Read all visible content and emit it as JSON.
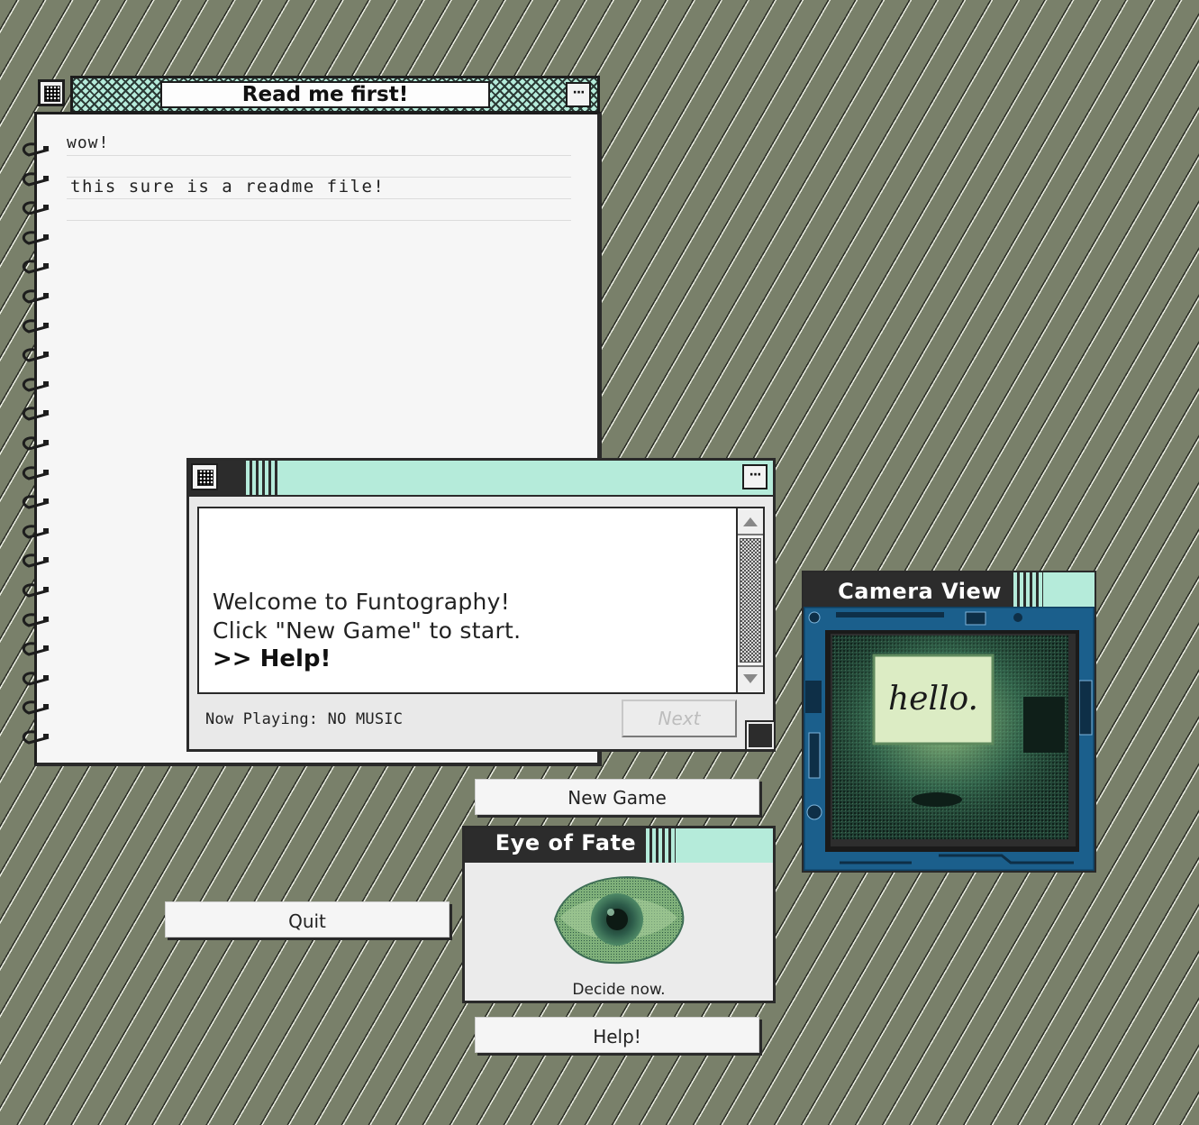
{
  "readme_window": {
    "title": "Read me first!",
    "menu_label": "···",
    "lines": [
      "wow!",
      "this sure is a readme file!"
    ]
  },
  "main_dialog": {
    "menu_label": "···",
    "message_line1": "Welcome to Funtography!",
    "message_line2": "Click \"New Game\" to start.",
    "help_link": ">> Help!",
    "now_playing": "Now Playing: NO MUSIC",
    "next_label": "Next"
  },
  "buttons": {
    "new_game": "New Game",
    "quit": "Quit",
    "help": "Help!"
  },
  "eye_window": {
    "title": "Eye of Fate",
    "caption": "Decide now."
  },
  "camera_window": {
    "title": "Camera View",
    "screen_text": "hello."
  },
  "colors": {
    "accent_mint": "#b5ebda",
    "desktop": "#79806a",
    "dark": "#2c2c2c"
  }
}
